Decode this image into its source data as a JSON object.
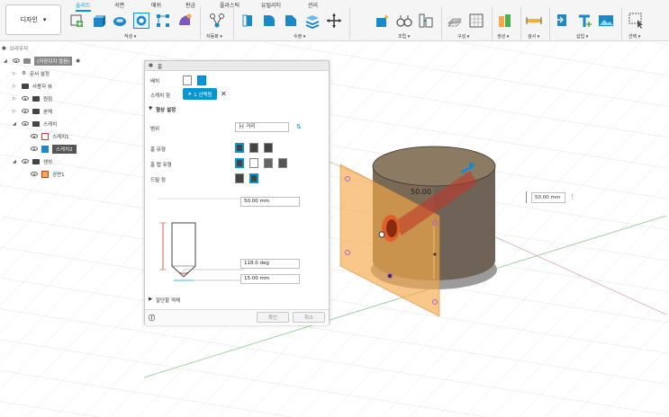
{
  "toolbar": {
    "workspace_label": "디자인",
    "tabs": [
      "솔리드",
      "곡면",
      "메쉬",
      "판금",
      "플라스틱",
      "유틸리티",
      "관리"
    ],
    "active_tab": "솔리드",
    "groups": {
      "create": "작성 ▾",
      "automate": "자동화 ▾",
      "modify": "수정 ▾",
      "assemble": "조립 ▾",
      "construct": "구성 ▾",
      "inspect": "검사 ▾",
      "insert": "삽입 ▾",
      "select": "선택 ▾",
      "generate": "생성 ▾"
    }
  },
  "browser": {
    "title": "브라우저",
    "root": "(저장되지 않음)",
    "items": [
      {
        "label": "문서 설정"
      },
      {
        "label": "사용자 뷰"
      },
      {
        "label": "원점"
      },
      {
        "label": "본체"
      },
      {
        "label": "스케치"
      },
      {
        "label": "스케치1"
      },
      {
        "label": "스케치2"
      },
      {
        "label": "생성"
      },
      {
        "label": "공면1"
      }
    ]
  },
  "dialog": {
    "title": "홈",
    "placement_label": "배치",
    "sketch_point_label": "스케치 점",
    "sketch_point_value": "1 선택됨",
    "shape_settings": "형상 설정",
    "extent_label": "범위",
    "extent_value": "거리",
    "hole_type_label": "홈 유형",
    "tap_type_label": "홈 탭 유형",
    "drill_point_label": "드릴 점",
    "depth_value": "50.00 mm",
    "angle_value": "118.0 deg",
    "diameter_value": "15.00 mm",
    "objects_to_cut": "잘단할 객체",
    "ok_label": "확인",
    "cancel_label": "취소"
  },
  "viewport": {
    "dimension_label": "50.00",
    "dimension_input": "50.00 mm"
  },
  "colors": {
    "accent": "#0696d7",
    "body": "#6b5a44",
    "plane": "#f4a94a"
  }
}
